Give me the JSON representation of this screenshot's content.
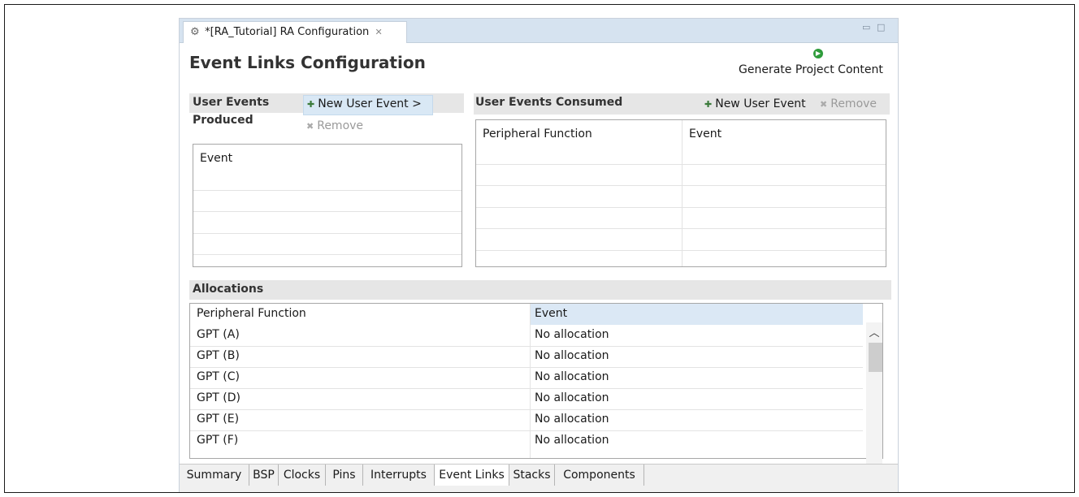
{
  "editor_tab": {
    "title": "*[RA_Tutorial] RA Configuration",
    "close": "✕"
  },
  "header": {
    "title": "Event Links Configuration",
    "generate_label": "Generate Project Content"
  },
  "produced": {
    "header": "User Events Produced",
    "header_line1": "User Events",
    "header_line2": "Produced",
    "new_btn": "New User Event >",
    "remove_btn": "Remove",
    "column": "Event"
  },
  "consumed": {
    "header": "User Events Consumed",
    "new_btn": "New User Event",
    "remove_btn": "Remove",
    "columns": [
      "Peripheral Function",
      "Event"
    ]
  },
  "allocations": {
    "header": "Allocations",
    "columns": [
      "Peripheral Function",
      "Event"
    ],
    "rows": [
      {
        "peripheral": "GPT (A)",
        "event": "No allocation"
      },
      {
        "peripheral": "GPT (B)",
        "event": "No allocation"
      },
      {
        "peripheral": "GPT (C)",
        "event": "No allocation"
      },
      {
        "peripheral": "GPT (D)",
        "event": "No allocation"
      },
      {
        "peripheral": "GPT (E)",
        "event": "No allocation"
      },
      {
        "peripheral": "GPT (F)",
        "event": "No allocation"
      }
    ]
  },
  "bottom_tabs": [
    "Summary",
    "BSP",
    "Clocks",
    "Pins",
    "Interrupts",
    "Event Links",
    "Stacks",
    "Components"
  ],
  "active_bottom_tab": "Event Links",
  "colors": {
    "accent": "#d6e3f0",
    "generate_icon": "#2e9c3b"
  }
}
